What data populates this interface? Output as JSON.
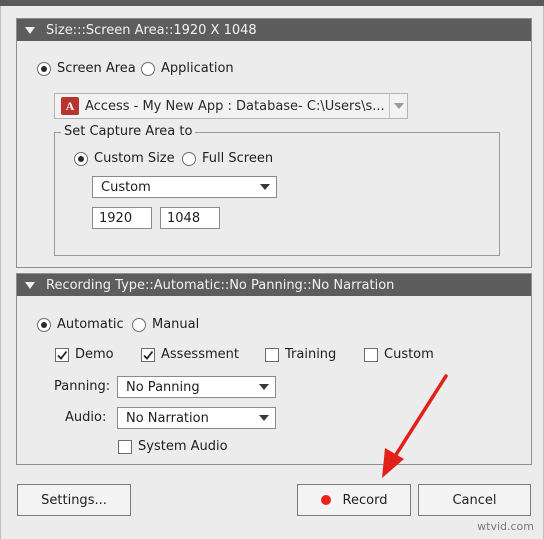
{
  "size_panel": {
    "header": "Size:::Screen Area::1920 X 1048",
    "radio_screen_area": "Screen Area",
    "radio_application": "Application",
    "app_select_value": "Access - My New App : Database- C:\\Users\\s...",
    "app_icon_letter": "A",
    "capture_group_label": "Set Capture Area to",
    "radio_custom_size": "Custom Size",
    "radio_full_screen": "Full Screen",
    "size_preset_value": "Custom",
    "width_value": "1920",
    "height_value": "1048"
  },
  "recording_panel": {
    "header": "Recording Type::Automatic::No Panning::No Narration",
    "radio_automatic": "Automatic",
    "radio_manual": "Manual",
    "check_demo": "Demo",
    "check_assessment": "Assessment",
    "check_training": "Training",
    "check_custom": "Custom",
    "panning_label": "Panning:",
    "panning_value": "No Panning",
    "audio_label": "Audio:",
    "audio_value": "No Narration",
    "system_audio_label": "System Audio"
  },
  "footer": {
    "settings_button": "Settings...",
    "record_button": "Record",
    "cancel_button": "Cancel"
  },
  "watermark": "wtvid.com",
  "colors": {
    "header_bg": "#5d5d5d",
    "dialog_bg": "#ececec",
    "record_dot": "#e8231a",
    "arrow": "#e3211b"
  }
}
